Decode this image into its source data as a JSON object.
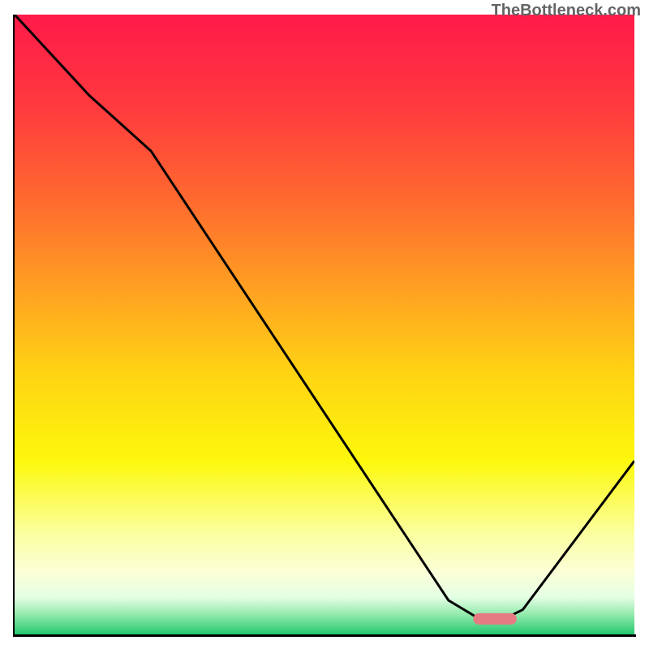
{
  "watermark": "TheBottleneck.com",
  "chart_data": {
    "type": "line",
    "title": "",
    "xlabel": "",
    "ylabel": "",
    "xlim": [
      0,
      100
    ],
    "ylim": [
      0,
      100
    ],
    "background_gradient": {
      "stops": [
        {
          "pos": 0.0,
          "color": "#ff1a4a"
        },
        {
          "pos": 0.15,
          "color": "#ff3a3e"
        },
        {
          "pos": 0.3,
          "color": "#ff6a2f"
        },
        {
          "pos": 0.45,
          "color": "#ffa321"
        },
        {
          "pos": 0.58,
          "color": "#ffd413"
        },
        {
          "pos": 0.72,
          "color": "#fdf80c"
        },
        {
          "pos": 0.84,
          "color": "#fbffa2"
        },
        {
          "pos": 0.9,
          "color": "#fbffd8"
        },
        {
          "pos": 0.94,
          "color": "#e4ffe4"
        },
        {
          "pos": 0.97,
          "color": "#8de8a8"
        },
        {
          "pos": 1.0,
          "color": "#23c86e"
        }
      ]
    },
    "series": [
      {
        "name": "bottleneck-curve",
        "color": "#000000",
        "x": [
          0,
          12,
          22,
          70,
          75,
          79,
          82,
          100
        ],
        "values": [
          100,
          87,
          78,
          5.5,
          2.5,
          2.5,
          4,
          28
        ]
      }
    ],
    "marker": {
      "name": "optimal-marker",
      "color": "#e77b84",
      "x_start": 74,
      "x_end": 81,
      "y": 2.5
    }
  }
}
